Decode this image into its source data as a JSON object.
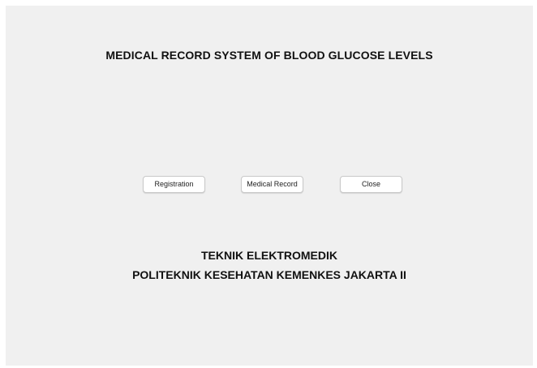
{
  "window": {
    "background": "#f0f0f0"
  },
  "header": {
    "title": "MEDICAL RECORD SYSTEM OF BLOOD GLUCOSE LEVELS"
  },
  "buttons": {
    "registration": "Registration",
    "medical_record": "Medical Record",
    "close": "Close"
  },
  "footer": {
    "line1": "TEKNIK ELEKTROMEDIK",
    "line2": "POLITEKNIK KESEHATAN KEMENKES JAKARTA II"
  }
}
